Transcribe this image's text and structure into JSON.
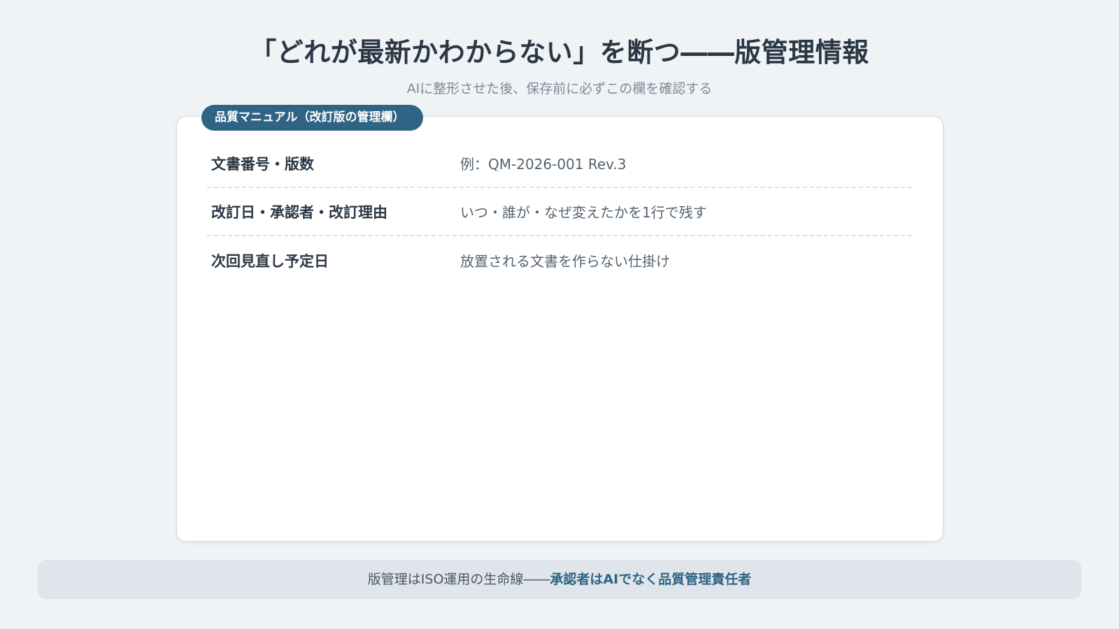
{
  "header": {
    "title": "「どれが最新かわからない」を断つ――版管理情報",
    "subtitle": "AIに整形させた後、保存前に必ずこの欄を確認する"
  },
  "card": {
    "tag": "品質マニュアル（改訂版の管理欄）",
    "rows": [
      {
        "label": "文書番号・版数",
        "value": "例：QM-2026-001 Rev.3"
      },
      {
        "label": "改訂日・承認者・改訂理由",
        "value": "いつ・誰が・なぜ変えたかを1行で残す"
      },
      {
        "label": "次回見直し予定日",
        "value": "放置される文書を作らない仕掛け"
      }
    ]
  },
  "footer": {
    "text": "版管理はISO運用の生命線――",
    "emphasis": "承認者はAIでなく品質管理責任者"
  },
  "colors": {
    "accent": "#2f6485",
    "background": "#eff3f6",
    "footer_background": "#dfe5ea"
  }
}
